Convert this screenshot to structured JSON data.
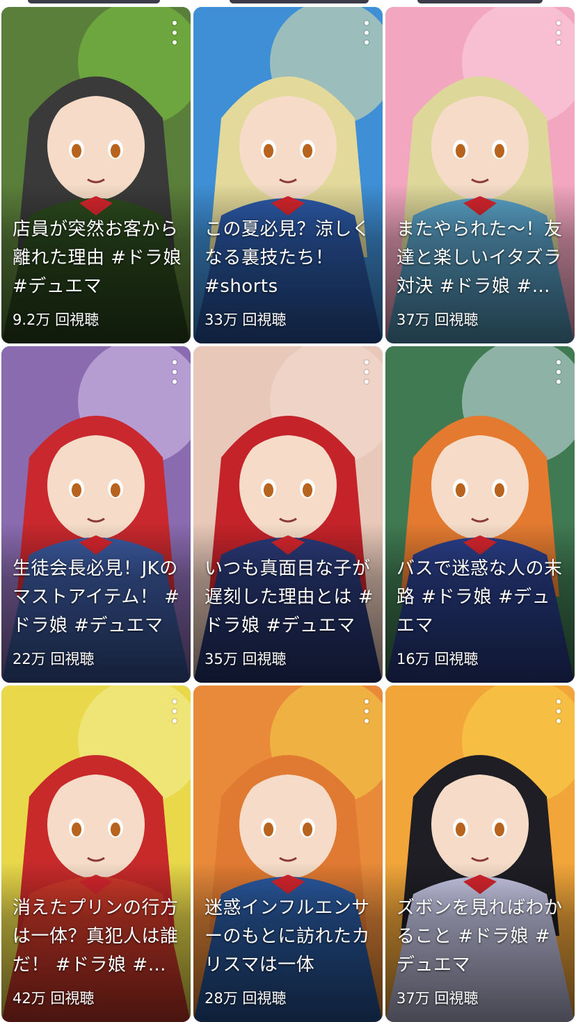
{
  "videos": [
    {
      "title": "店員が突然お客から離れた理由 #ドラ娘 #デュエマ",
      "views": "9.2万 回視聴",
      "colors": {
        "bg": "#5a7f3a",
        "accent": "#7ec644",
        "hair": "#3a3a3a",
        "sub": "#2c4a1e"
      }
    },
    {
      "title": "この夏必見？涼しくなる裏技たち！ #shorts",
      "views": "33万 回視聴",
      "colors": {
        "bg": "#3f8fd6",
        "accent": "#e8e4a8",
        "hair": "#e2d99a",
        "sub": "#2c5aa8"
      }
    },
    {
      "title": "またやられた〜！友達と楽しいイタズラ対決 #ドラ娘 #デュエマ",
      "views": "37万 回視聴",
      "colors": {
        "bg": "#f3a6c0",
        "accent": "#fbd2de",
        "hair": "#ddd79a",
        "sub": "#5aa2c8"
      }
    },
    {
      "title": "生徒会長必見！JKのマストアイテム！ #ドラ娘 #デュエマ",
      "views": "22万 回視聴",
      "colors": {
        "bg": "#8a6bb0",
        "accent": "#d9c6ee",
        "hair": "#c8282e",
        "sub": "#3c5aa0"
      }
    },
    {
      "title": "いつも真面目な子が遅刻した理由とは #ドラ娘 #デュエマ",
      "views": "35万 回視聴",
      "colors": {
        "bg": "#e8c8b8",
        "accent": "#f2ddd2",
        "hair": "#c4232a",
        "sub": "#2a3a78"
      }
    },
    {
      "title": "バスで迷惑な人の末路 #ドラ娘 #デュエマ",
      "views": "16万 回視聴",
      "colors": {
        "bg": "#3f7a52",
        "accent": "#cfe0ea",
        "hair": "#e37a30",
        "sub": "#2a3f8a"
      }
    },
    {
      "title": "消えたプリンの行方は一体？真犯人は誰だ！ #ドラ娘 #デュエマ",
      "views": "42万 回視聴",
      "colors": {
        "bg": "#e8d84a",
        "accent": "#f4ee9a",
        "hair": "#c82a2a",
        "sub": "#d23a2a"
      }
    },
    {
      "title": "迷惑インフルエンサーのもとに訪れたカリスマは一体",
      "views": "28万 回視聴",
      "colors": {
        "bg": "#e88a3a",
        "accent": "#f5d24a",
        "hair": "#e07a32",
        "sub": "#2a5aa0"
      }
    },
    {
      "title": "ズボンを見ればわかること #ドラ娘 #デュエマ",
      "views": "37万 回視聴",
      "colors": {
        "bg": "#f2a63a",
        "accent": "#f9d34c",
        "hair": "#1e1e24",
        "sub": "#c8c8e8"
      }
    }
  ]
}
